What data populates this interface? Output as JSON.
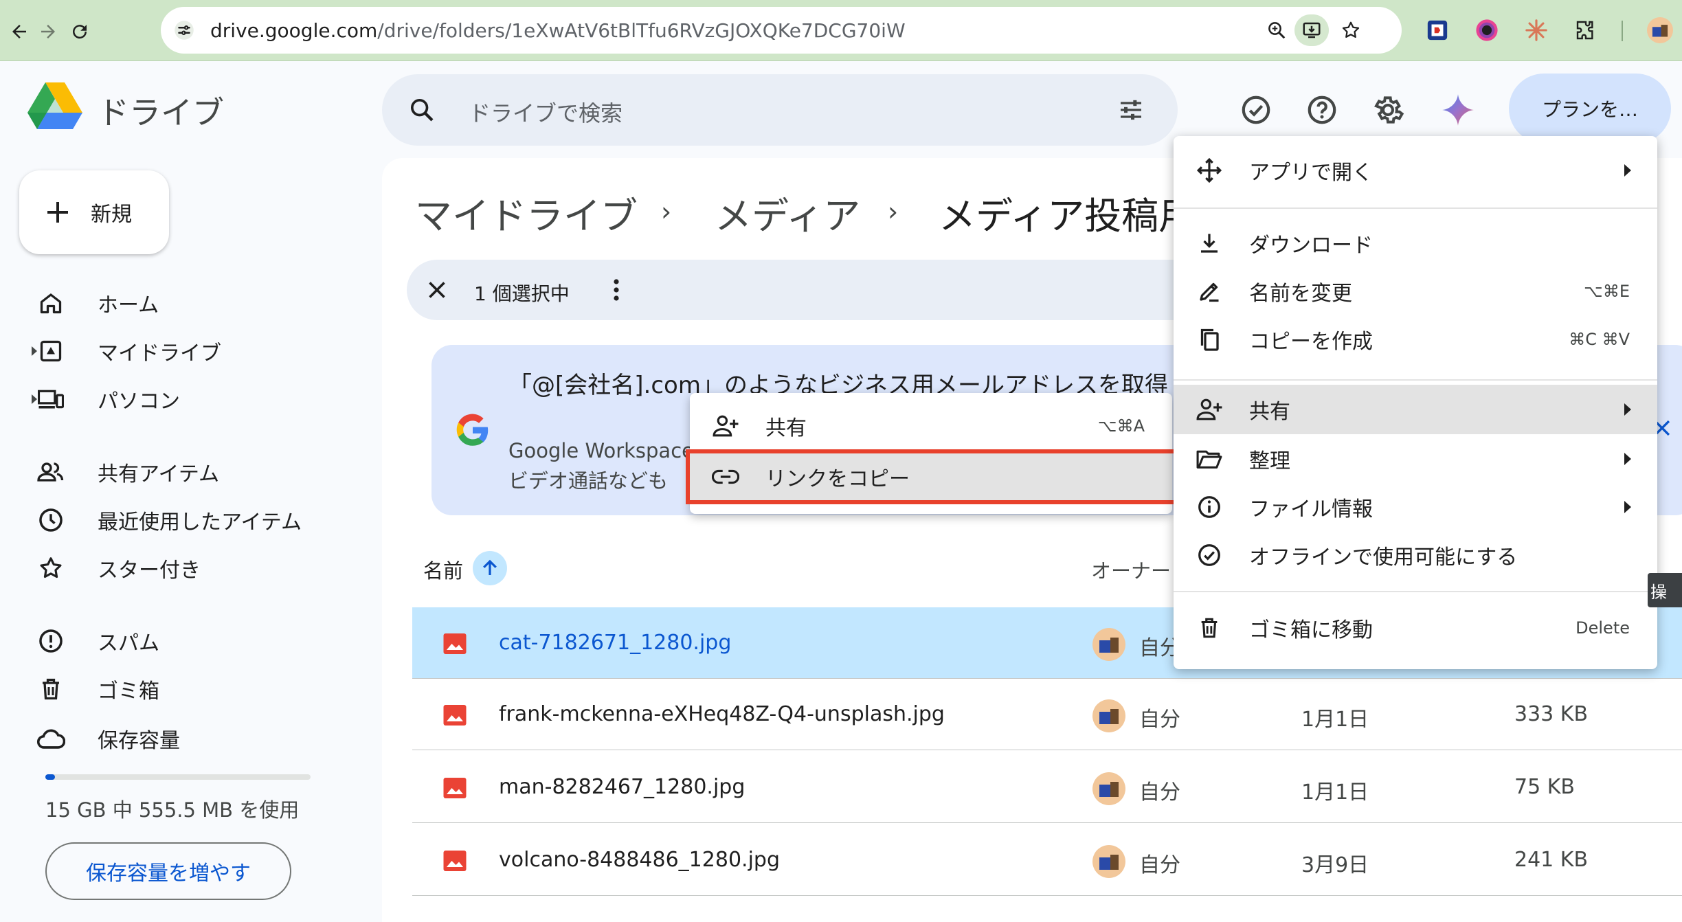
{
  "browser": {
    "url_host": "drive.google.com",
    "url_path": "/drive/folders/1eXwAtV6tBlTfu6RVzGJOXQKe7DCG70iW"
  },
  "header": {
    "app_title": "ドライブ",
    "search_placeholder": "ドライブで検索",
    "plan_button": "プランを…"
  },
  "sidebar": {
    "new_button": "新規",
    "items": [
      {
        "label": "ホーム"
      },
      {
        "label": "マイドライブ"
      },
      {
        "label": "パソコン"
      },
      {
        "label": "共有アイテム"
      },
      {
        "label": "最近使用したアイテム"
      },
      {
        "label": "スター付き"
      },
      {
        "label": "スパム"
      },
      {
        "label": "ゴミ箱"
      },
      {
        "label": "保存容量"
      }
    ],
    "storage_used_fraction": 0.036,
    "storage_text": "15 GB 中 555.5 MB を使用",
    "storage_button": "保存容量を増やす"
  },
  "breadcrumb": [
    "マイドライブ",
    "メディア",
    "メディア投稿用"
  ],
  "selection": {
    "count_text": "1 個選択中"
  },
  "promo": {
    "title": "「@[会社名].com」のようなビジネス用メールアドレスを取得しましょう",
    "subtitle_line1": "Google Workspace",
    "subtitle_line2": "ビデオ通話なども"
  },
  "table": {
    "col_name": "名前",
    "col_owner": "オーナー",
    "rows": [
      {
        "name": "cat-7182671_1280.jpg",
        "owner": "自分",
        "date": "",
        "size": "",
        "selected": true
      },
      {
        "name": "frank-mckenna-eXHeq48Z-Q4-unsplash.jpg",
        "owner": "自分",
        "date": "1月1日",
        "size": "333 KB"
      },
      {
        "name": "man-8282467_1280.jpg",
        "owner": "自分",
        "date": "1月1日",
        "size": "75 KB"
      },
      {
        "name": "volcano-8488486_1280.jpg",
        "owner": "自分",
        "date": "3月9日",
        "size": "241 KB"
      }
    ]
  },
  "context_menu": {
    "open_with": "アプリで開く",
    "download": "ダウンロード",
    "rename": "名前を変更",
    "rename_shortcut": "⌥⌘E",
    "make_copy": "コピーを作成",
    "make_copy_shortcut": "⌘C ⌘V",
    "share": "共有",
    "organize": "整理",
    "file_info": "ファイル情報",
    "offline": "オフラインで使用可能にする",
    "trash": "ゴミ箱に移動",
    "trash_shortcut": "Delete"
  },
  "share_submenu": {
    "share": "共有",
    "share_shortcut": "⌥⌘A",
    "copy_link": "リンクをコピー"
  },
  "tooltip_fragment": "操",
  "colors": {
    "accent": "#0b57d0",
    "selected_row": "#c2e7ff",
    "highlight": "#e8412c",
    "browser_frame": "#cfe6c8"
  }
}
